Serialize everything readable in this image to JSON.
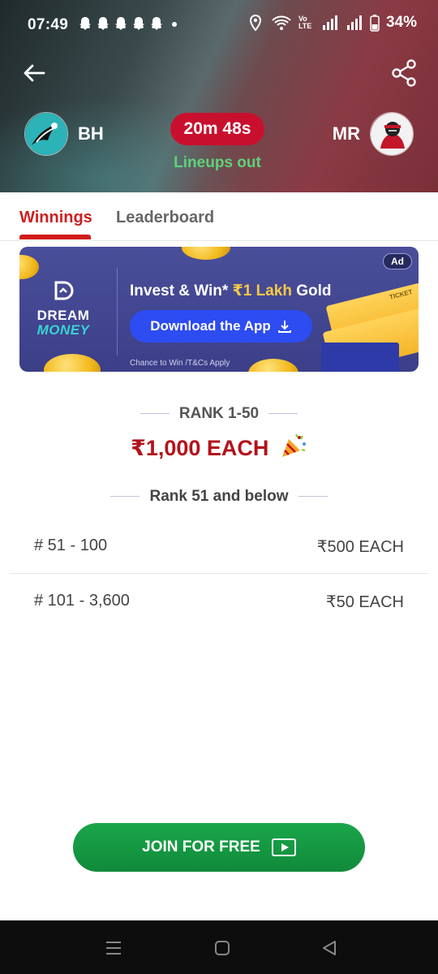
{
  "status_bar": {
    "time": "07:49",
    "battery": "34%",
    "network_label": "Vo LTE"
  },
  "header": {
    "team_left": "BH",
    "team_right": "MR",
    "timer": "20m 48s",
    "status": "Lineups out"
  },
  "tabs": [
    "Winnings",
    "Leaderboard"
  ],
  "ad": {
    "badge": "Ad",
    "logo_line1": "DREAM",
    "logo_line2": "MONEY",
    "headline_pre": "Invest & Win* ",
    "headline_gold": "₹1 Lakh",
    "headline_post": " Gold",
    "cta": "Download the App",
    "fineprint": "Chance to Win /T&Cs Apply",
    "ticket_text": "TICKET"
  },
  "prizes": {
    "top_label": "RANK 1-50",
    "top_amount": "₹1,000 EACH",
    "sub_label": "Rank 51 and below",
    "rows": [
      {
        "range": "# 51 - 100",
        "amount": "₹500 EACH"
      },
      {
        "range": "# 101 - 3,600",
        "amount": "₹50 EACH"
      }
    ]
  },
  "join_button": "JOIN FOR FREE",
  "colors": {
    "accent_red": "#cc1f1f",
    "timer_bg": "#c8102e",
    "lineups_green": "#5ed37a",
    "join_green": "#16a048",
    "ad_bg": "#434793"
  }
}
